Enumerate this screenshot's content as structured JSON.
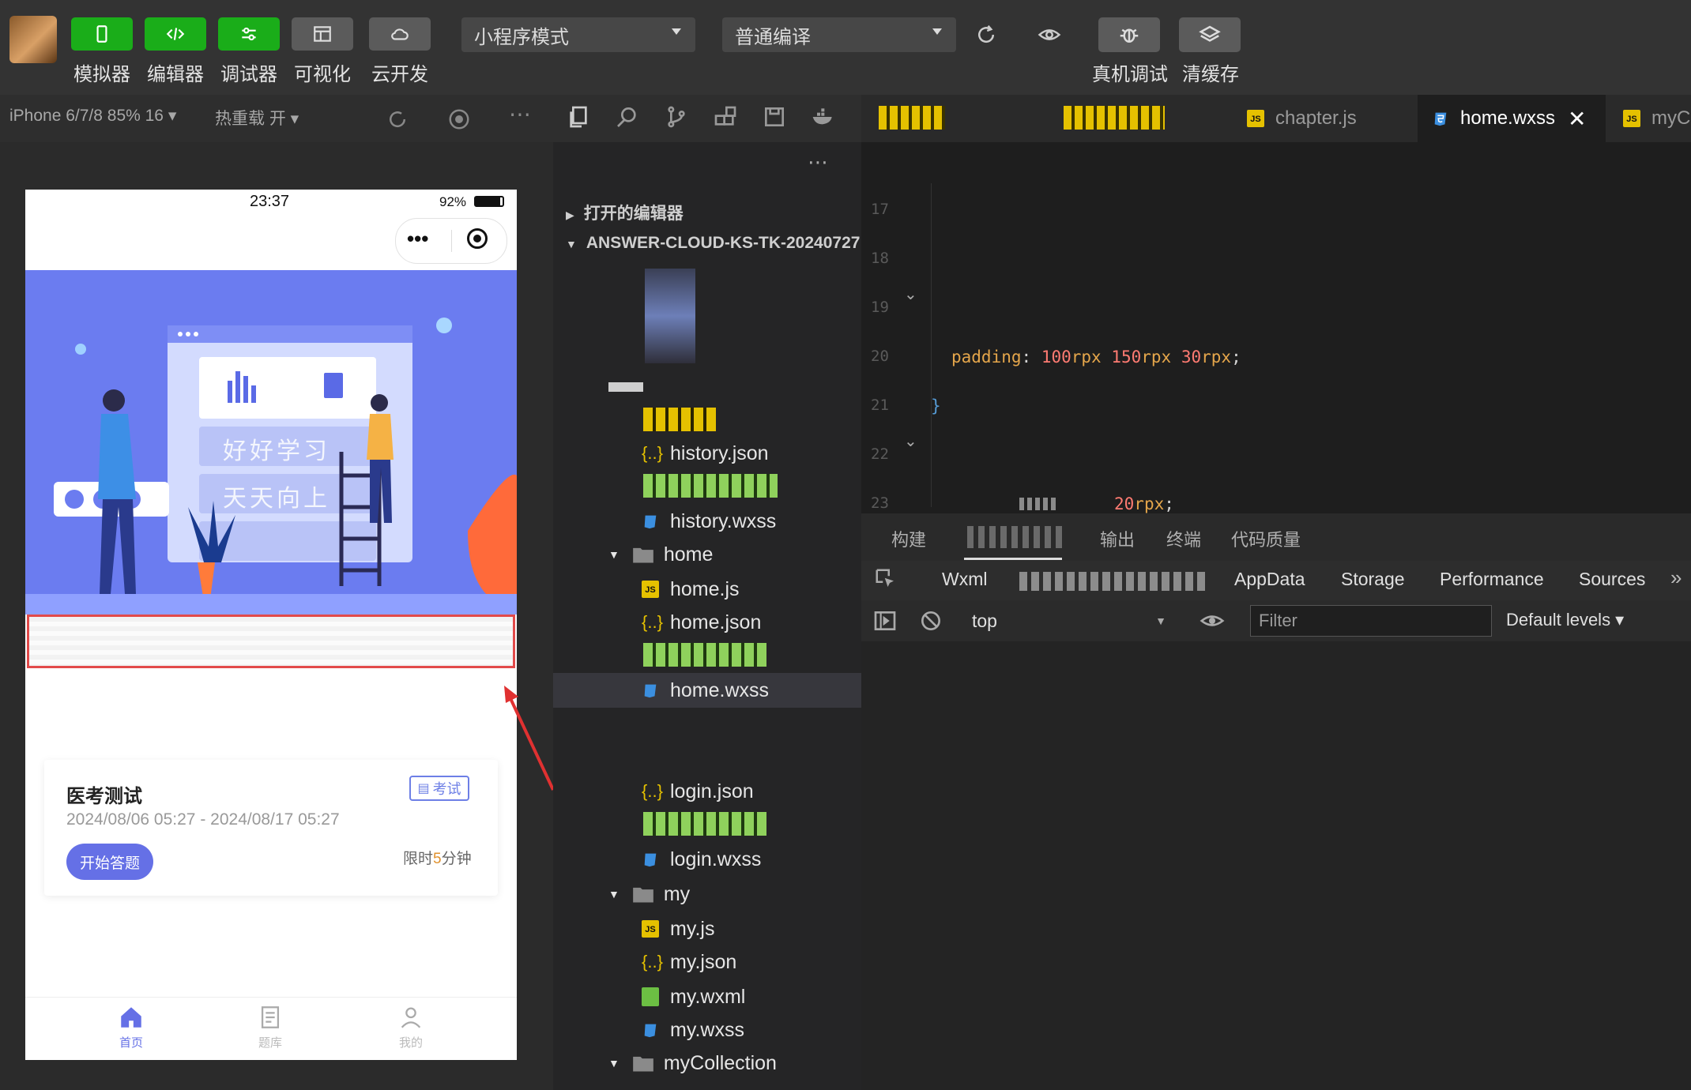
{
  "toolbar": {
    "buttons": [
      {
        "label": "模拟器",
        "icon": "phone-icon"
      },
      {
        "label": "编辑器",
        "icon": "code-icon"
      },
      {
        "label": "调试器",
        "icon": "debug-icon"
      },
      {
        "label": "可视化",
        "icon": "layout-icon"
      },
      {
        "label": "云开发",
        "icon": "cloud-icon"
      }
    ],
    "mode_select": "小程序模式",
    "compile_select": "普通编译",
    "real_debug_label": "真机调试",
    "clear_cache_label": "清缓存"
  },
  "subbar": {
    "device": "iPhone 6/7/8 85% 16 ▾",
    "hot_reload": "热重载 开 ▾"
  },
  "tabs": [
    {
      "label": "chapter.js",
      "type": "js"
    },
    {
      "label": "home.wxss",
      "type": "wxss",
      "active": true
    },
    {
      "label": "myC",
      "type": "js"
    }
  ],
  "phone": {
    "time": "23:37",
    "battery": "92%",
    "battery_level": 0.92,
    "banner_text_1": "好好学习",
    "banner_text_2": "天天向上",
    "exam": {
      "title": "医考测试",
      "tag": "考试",
      "time_range": "2024/08/06 05:27 - 2024/08/17 05:27",
      "start_label": "开始答题",
      "limit_prefix": "限时",
      "limit_value": "5",
      "limit_suffix": "分钟"
    },
    "tabbar": [
      {
        "label": "首页",
        "icon": "home-icon",
        "active": true
      },
      {
        "label": "题库",
        "icon": "document-icon"
      },
      {
        "label": "我的",
        "icon": "user-icon"
      }
    ]
  },
  "explorer": {
    "open_editors": "打开的编辑器",
    "project": "ANSWER-CLOUD-KS-TK-20240727",
    "items": {
      "history_json": "history.json",
      "history_wxss": "history.wxss",
      "home_folder": "home",
      "home_js": "home.js",
      "home_json": "home.json",
      "home_wxss": "home.wxss",
      "login_json": "login.json",
      "login_wxss": "login.wxss",
      "my_folder": "my",
      "my_js": "my.js",
      "my_json": "my.json",
      "my_wxml": "my.wxml",
      "my_wxss": "my.wxss",
      "mycollection_folder": "myCollection"
    }
  },
  "editor": {
    "line_numbers": [
      "17",
      "18",
      "19",
      "20",
      "21",
      "22",
      "23"
    ],
    "code_prop": "padding",
    "code_colon": ": ",
    "code_v1": "100",
    "code_u1": "rpx ",
    "code_v2": "150",
    "code_u2": "rpx ",
    "code_v3": "30",
    "code_u3": "rpx",
    "code_semi": ";",
    "code_brace": "}",
    "code_last_value": "20",
    "code_last_unit": "rpx",
    "code_last_semi": ";"
  },
  "devtools": {
    "bottom_tabs": [
      "构建",
      "输出",
      "终端",
      "代码质量"
    ],
    "panel_tabs": [
      "Wxml",
      "AppData",
      "Storage",
      "Performance",
      "Sources"
    ],
    "context": "top",
    "filter_placeholder": "Filter",
    "levels": "Default levels ▾"
  },
  "colors": {
    "accent_green": "#1aad19",
    "banner_blue": "#6b7cf0",
    "primary_button": "#6570e6",
    "editor_bg": "#1e1e1e"
  }
}
